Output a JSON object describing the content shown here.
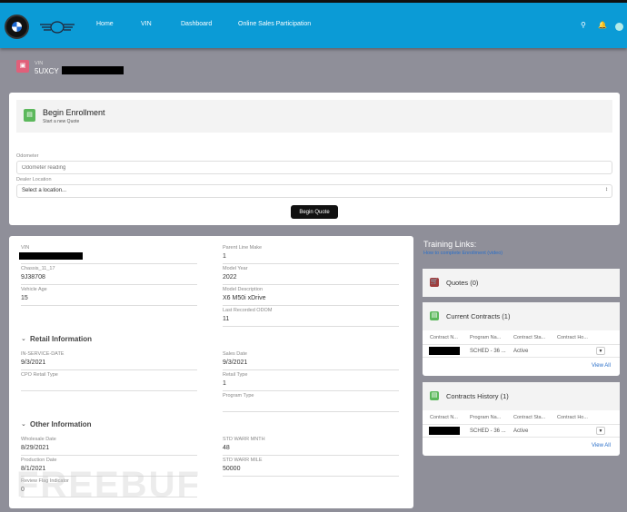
{
  "nav": {
    "items": [
      "Home",
      "VIN",
      "Dashboard",
      "Online Sales Participation"
    ]
  },
  "colors": {
    "header": "#0b9bd6",
    "background": "#8f8f99",
    "vin_icon": "#e0607a",
    "enroll_icon": "#5cb85c",
    "quotes_icon": "#a03c3c",
    "button": "#111111"
  },
  "icons": [
    "search-icon",
    "bell-icon",
    "user-avatar-icon",
    "car-icon",
    "document-icon",
    "cart-icon",
    "chevron-down-icon"
  ],
  "record": {
    "label": "VIN",
    "value": "5UXCY"
  },
  "enroll": {
    "title": "Begin Enrollment",
    "subtitle": "Start a new Quote",
    "odometer_label": "Odometer",
    "odometer_placeholder": "Odometer reading",
    "dealer_label": "Dealer Location",
    "dealer_value": "Select a location...",
    "button": "Begin Quote"
  },
  "details": {
    "left": [
      {
        "label": "VIN",
        "value": ""
      },
      {
        "label": "Chassis_11_17",
        "value": "9J38708"
      },
      {
        "label": "Vehicle Age",
        "value": "15"
      }
    ],
    "right": [
      {
        "label": "Parent Line Make",
        "value": "1"
      },
      {
        "label": "Model Year",
        "value": "2022"
      },
      {
        "label": "Model Description",
        "value": "X6 M50i xDrive"
      },
      {
        "label": "Last Recorded ODOM",
        "value": "11"
      }
    ],
    "retail_title": "Retail Information",
    "retail_left": [
      {
        "label": "IN-SERVICE-DATE",
        "value": "9/3/2021"
      },
      {
        "label": "CPO Retail Type",
        "value": ""
      }
    ],
    "retail_right": [
      {
        "label": "Sales Date",
        "value": "9/3/2021"
      },
      {
        "label": "Retail Type",
        "value": "1"
      },
      {
        "label": "Program Type",
        "value": ""
      }
    ],
    "other_title": "Other Information",
    "other_left": [
      {
        "label": "Wholesale Date",
        "value": "8/29/2021"
      },
      {
        "label": "Production Date",
        "value": "8/1/2021"
      },
      {
        "label": "Review Flag Indicator",
        "value": "0"
      }
    ],
    "other_right": [
      {
        "label": "STD WARR MNTH",
        "value": "48"
      },
      {
        "label": "STD WARR MILE",
        "value": "50000"
      }
    ]
  },
  "training": {
    "title": "Training Links:",
    "link": "How to complete Enrollment (video)"
  },
  "quotes": {
    "title": "Quotes (0)"
  },
  "current": {
    "title": "Current Contracts (1)",
    "columns": [
      "Contract N...",
      "Program Na...",
      "Contract Sta...",
      "Contract Ho..."
    ],
    "row": {
      "program": "SCHED - 36 ...",
      "status": "Active"
    },
    "view_all": "View All"
  },
  "history": {
    "title": "Contracts History (1)",
    "columns": [
      "Contract N...",
      "Program Na...",
      "Contract Sta...",
      "Contract Ho..."
    ],
    "row": {
      "program": "SCHED - 36 ...",
      "status": "Active"
    },
    "view_all": "View All"
  },
  "watermark": "FREEBUF"
}
